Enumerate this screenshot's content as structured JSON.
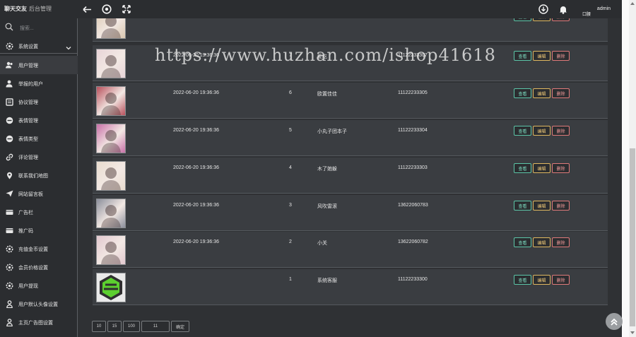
{
  "header": {
    "brand": "聊天交友",
    "subtitle": "后台管理",
    "user": "admin",
    "avatar_label": "口腰"
  },
  "sidebar": {
    "search_placeholder": "搜索...",
    "system_label": "系统设置",
    "items": [
      {
        "label": "用户管理",
        "icon": "users-icon",
        "active": true
      },
      {
        "label": "举报的用户",
        "icon": "user-report-icon"
      },
      {
        "label": "协议管理",
        "icon": "document-icon"
      },
      {
        "label": "表情管理",
        "icon": "smile-icon"
      },
      {
        "label": "表情类型",
        "icon": "smile-type-icon"
      },
      {
        "label": "评论管理",
        "icon": "link-icon"
      },
      {
        "label": "联系我们地图",
        "icon": "map-pin-icon"
      },
      {
        "label": "网站留言板",
        "icon": "send-icon"
      },
      {
        "label": "广告栏",
        "icon": "card-icon"
      },
      {
        "label": "推广码",
        "icon": "card-icon"
      },
      {
        "label": "充值金币设置",
        "icon": "gear-icon"
      },
      {
        "label": "会员价格设置",
        "icon": "gear-icon"
      },
      {
        "label": "用户提现",
        "icon": "gear-icon"
      },
      {
        "label": "用户默认头像设置",
        "icon": "user-icon"
      },
      {
        "label": "主页广告图设置",
        "icon": "user-icon"
      }
    ]
  },
  "table": {
    "actions": {
      "view": "查看",
      "edit": "编辑",
      "delete": "删除"
    },
    "rows": [
      {
        "date": "",
        "id": "",
        "name": "",
        "phone": "",
        "thumb_color": "#d9c7b0"
      },
      {
        "date": "2022-06-20 19:36:36",
        "id": "7",
        "name": "爱吃",
        "phone": "11122233307",
        "thumb_color": "#e8d4d8"
      },
      {
        "date": "2022-06-20 19:36:36",
        "id": "6",
        "name": "欧置佳佳",
        "phone": "11122233305",
        "thumb_color": "#b8505c"
      },
      {
        "date": "2022-06-20 19:36:36",
        "id": "5",
        "name": "小丸子团本子",
        "phone": "11122233304",
        "thumb_color": "#c870a8"
      },
      {
        "date": "2022-06-20 19:36:36",
        "id": "4",
        "name": "木了她躲",
        "phone": "11122233303",
        "thumb_color": "#e9dccf"
      },
      {
        "date": "2022-06-20 19:36:36",
        "id": "3",
        "name": "风吹雷滚",
        "phone": "13622060783",
        "thumb_color": "#8b8f9c"
      },
      {
        "date": "2022-06-20 19:36:36",
        "id": "2",
        "name": "小关",
        "phone": "13622060782",
        "thumb_color": "#e2c8cf"
      },
      {
        "date": "",
        "id": "1",
        "name": "系统客服",
        "phone": "11122233300",
        "thumb_color": "#3f7f3f"
      }
    ]
  },
  "pager": {
    "p1": "10",
    "p2": "15",
    "p3": "100",
    "current": "11",
    "go": "确定"
  },
  "watermark": "https://www.huzhan.com/ishop41618"
}
